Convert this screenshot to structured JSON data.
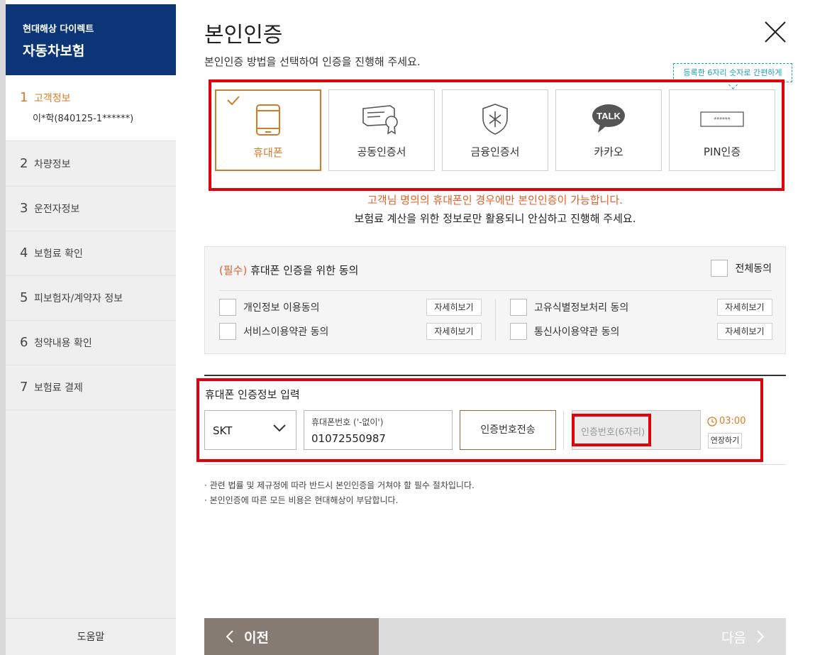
{
  "sidebar": {
    "brand_top": "현대해상 다이렉트",
    "brand_main": "자동차보험",
    "steps": [
      {
        "num": "1",
        "label": "고객정보",
        "sub": "이*학(840125-1******)"
      },
      {
        "num": "2",
        "label": "차량정보"
      },
      {
        "num": "3",
        "label": "운전자정보"
      },
      {
        "num": "4",
        "label": "보험료 확인"
      },
      {
        "num": "5",
        "label": "피보험자/계약자 정보"
      },
      {
        "num": "6",
        "label": "청약내용 확인"
      },
      {
        "num": "7",
        "label": "보험료 결제"
      }
    ],
    "help": "도움말"
  },
  "main": {
    "title": "본인인증",
    "subtitle": "본인인증 방법을 선택하여 인증을 진행해 주세요.",
    "tip": "등록한 6자리 숫자로 간편하게",
    "methods": [
      {
        "label": "휴대폰",
        "icon": "mobile-phone-icon",
        "selected": true
      },
      {
        "label": "공동인증서",
        "icon": "certificate-icon",
        "selected": false
      },
      {
        "label": "금융인증서",
        "icon": "shield-key-icon",
        "selected": false
      },
      {
        "label": "카카오",
        "icon": "kakao-talk-icon",
        "icon_text": "TALK",
        "selected": false
      },
      {
        "label": "PIN인증",
        "icon": "pin-code-icon",
        "icon_text": "******",
        "selected": false
      }
    ],
    "notice_orange": "고객님 명의의 휴대폰인 경우에만 본인인증이 가능합니다.",
    "notice_black": "보험료 계산을 위한 정보로만 활용되니 안심하고 진행해 주세요.",
    "agree": {
      "title_required": "(필수)",
      "title": " 휴대폰 인증을 위한 동의",
      "all_label": "전체동의",
      "detail_label": "자세히보기",
      "items": [
        "개인정보 이용동의",
        "서비스이용약관 동의",
        "고유식별정보처리 동의",
        "통신사이용약관 동의"
      ]
    },
    "input_section": {
      "title": "휴대폰 인증정보 입력",
      "carrier": "SKT",
      "phone_label": "휴대폰번호 ('-없이')",
      "phone_value": "01072550987",
      "send_button": "인증번호전송",
      "code_placeholder": "인증번호(6자리)",
      "timer": "03:00",
      "extend_button": "연장하기"
    },
    "notes": [
      "관련 법률 및 제규정에 따라 반드시 본인인증을 거쳐야 할 필수 절차입니다.",
      "본인인증에 따른 모든 비용은 현대해상이 부담합니다."
    ],
    "nav": {
      "prev": "이전",
      "next": "다음"
    }
  },
  "colors": {
    "brand_navy": "#0b3576",
    "accent_orange": "#d37a2b",
    "highlight_red": "#e0000b",
    "tip_teal": "#1aa3b2"
  }
}
